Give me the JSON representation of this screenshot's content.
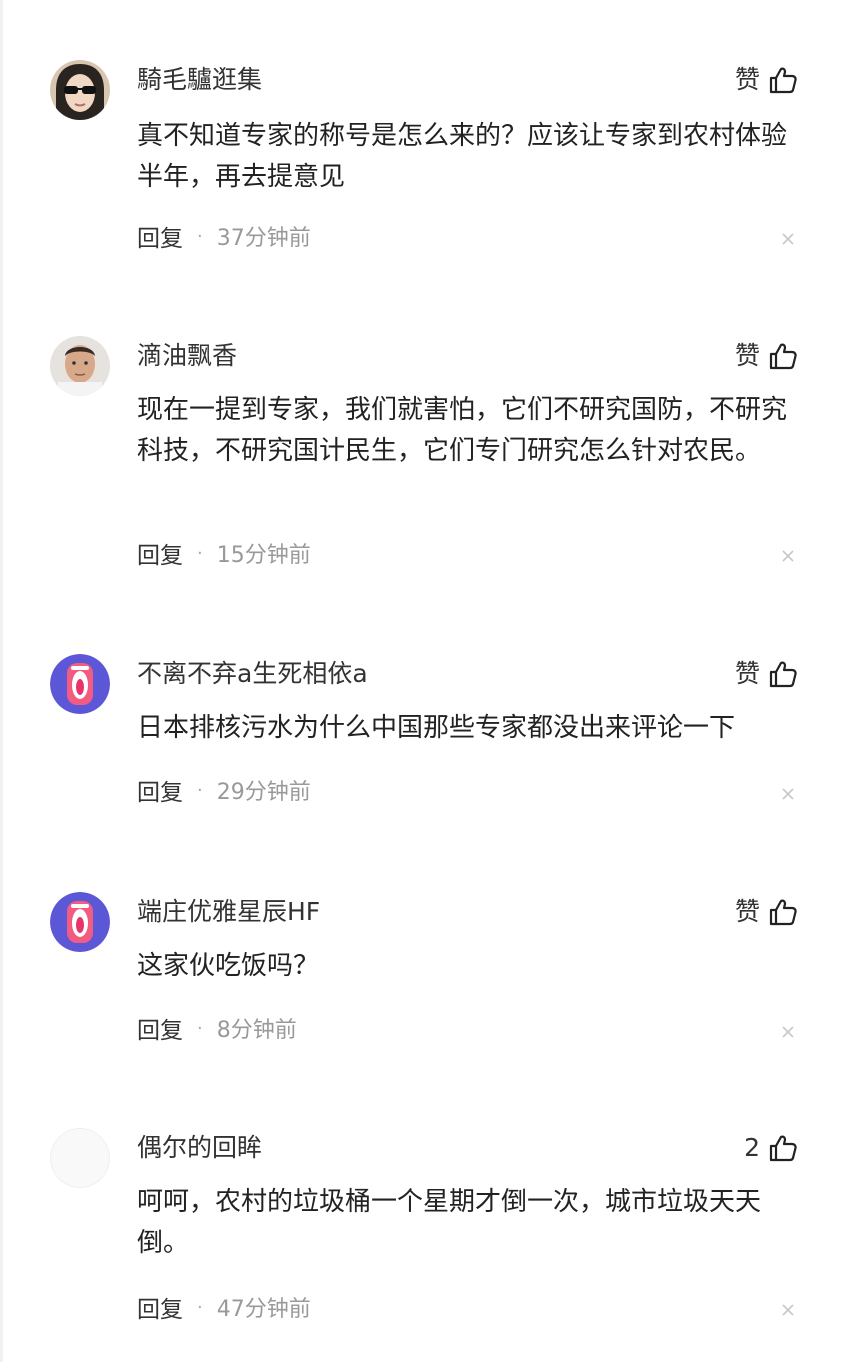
{
  "like_label": "赞",
  "comments": [
    {
      "username": "騎毛驢逛集",
      "content": "真不知道专家的称号是怎么来的？应该让专家到农村体验半年，再去提意见",
      "likes": "赞",
      "reply": "回复",
      "separator": "·",
      "time": "37分钟前",
      "avatar": "sunglasses-person-avatar"
    },
    {
      "username": "滴油飘香",
      "content": "现在一提到专家，我们就害怕，它们不研究国防，不研究科技，不研究国计民生，它们专门研究怎么针对农民。",
      "likes": "赞",
      "reply": "回复",
      "separator": "·",
      "time": "15分钟前",
      "avatar": "man-photo-avatar"
    },
    {
      "username": "不离不弃a生死相依a",
      "content": "日本排核污水为什么中国那些专家都没出来评论一下",
      "likes": "赞",
      "reply": "回复",
      "separator": "·",
      "time": "29分钟前",
      "avatar": "screaming-mouth-avatar"
    },
    {
      "username": "端庄优雅星辰HF",
      "content": "这家伙吃饭吗？",
      "likes": "赞",
      "reply": "回复",
      "separator": "·",
      "time": "8分钟前",
      "avatar": "screaming-mouth-avatar"
    },
    {
      "username": "偶尔的回眸",
      "content": "呵呵，农村的垃圾桶一个星期才倒一次，城市垃圾天天倒。",
      "likes": "2",
      "reply": "回复",
      "separator": "·",
      "time": "47分钟前",
      "avatar": "blank-avatar"
    }
  ]
}
